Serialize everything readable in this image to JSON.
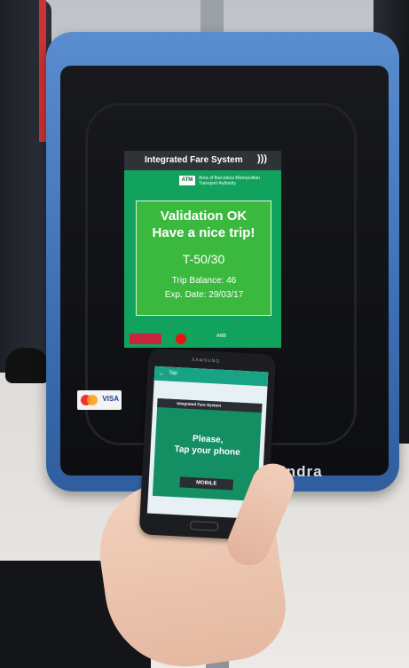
{
  "validator": {
    "brand": "Indra",
    "card_logo_visa": "VISA"
  },
  "screen": {
    "header": "Integrated Fare System",
    "header_icon": "nfc-icon",
    "logo_text": "ATM",
    "authority": "Area of Barcelona Metropolitan Transport Authority",
    "message_line1": "Validation OK",
    "message_line2": "Have a nice trip!",
    "ticket": "T-50/30",
    "balance": "Trip Balance: 46",
    "expiry": "Exp. Date: 29/03/17",
    "footer_logo": "AMB",
    "accent_color": "#11a35e",
    "box_color": "#3bb93e"
  },
  "phone": {
    "brand": "SAMSUNG",
    "app_title": "Tap",
    "panel_header": "Integrated Fare System",
    "prompt_line1": "Please,",
    "prompt_line2": "Tap your phone",
    "mobile_label": "MOBILE"
  }
}
